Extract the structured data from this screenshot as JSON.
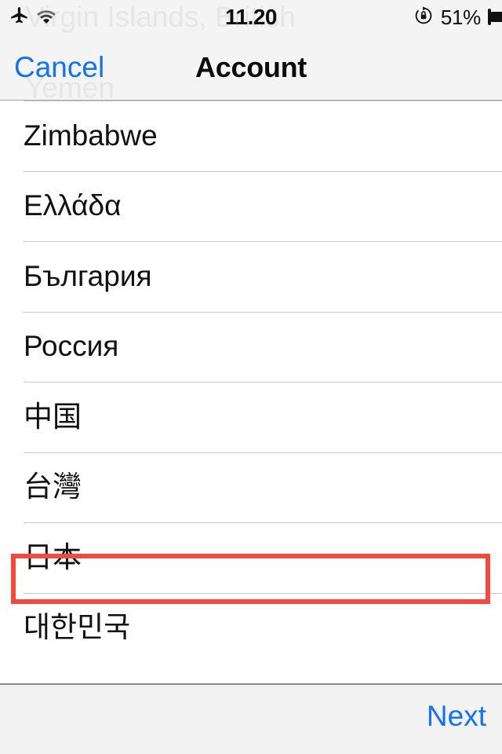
{
  "status_bar": {
    "airplane_icon": "airplane-mode-icon",
    "wifi_icon": "wifi-icon",
    "time": "11.20",
    "rotation_lock_icon": "rotation-lock-icon",
    "battery_percent": "51%",
    "battery_level": 51
  },
  "ghost_rows": {
    "upper": "Virgin Islands, British",
    "lower": "Yemen"
  },
  "nav_bar": {
    "cancel_label": "Cancel",
    "title": "Account"
  },
  "list": {
    "rows": [
      {
        "label": "Zimbabwe",
        "highlighted": false
      },
      {
        "label": "Ελλάδα",
        "highlighted": false
      },
      {
        "label": "България",
        "highlighted": false
      },
      {
        "label": "Россия",
        "highlighted": false
      },
      {
        "label": "中国",
        "highlighted": false
      },
      {
        "label": "台灣",
        "highlighted": false
      },
      {
        "label": "日本",
        "highlighted": true
      },
      {
        "label": "대한민국",
        "highlighted": false
      }
    ]
  },
  "toolbar": {
    "next_label": "Next"
  },
  "colors": {
    "accent_blue": "#1272f0",
    "highlight_red": "#f4493b",
    "chrome_gray": "#f4f4f4",
    "toolbar_gray": "#f2f2f2",
    "separator": "#c6c6c8",
    "ghost_text": "#e6e6e6"
  }
}
